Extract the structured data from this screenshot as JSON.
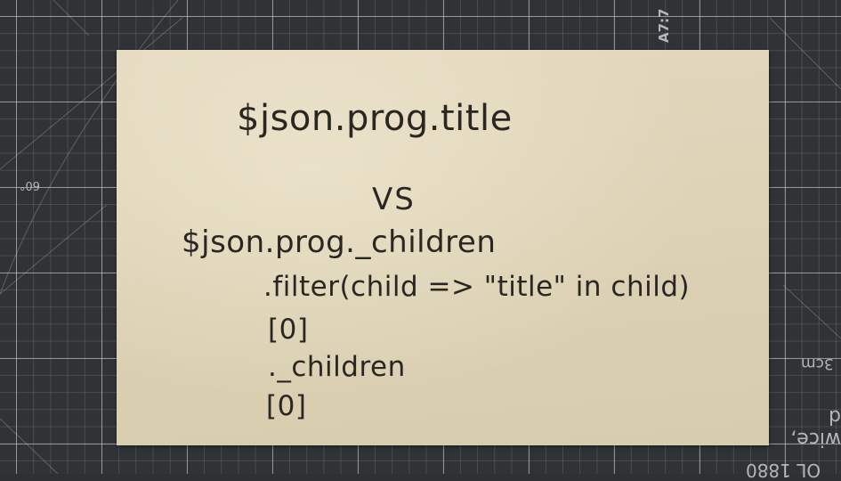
{
  "mat": {
    "marks": {
      "left": "60°",
      "top": "A7:7",
      "right_1": "3cm",
      "right_2": "wice, d",
      "right_3": "OL 1880"
    }
  },
  "note": {
    "lines": [
      "$json.prog.title",
      "VS",
      "$json.prog._children",
      ".filter(child => \"title\" in child)",
      "[0]",
      "._children",
      "[0]"
    ]
  }
}
